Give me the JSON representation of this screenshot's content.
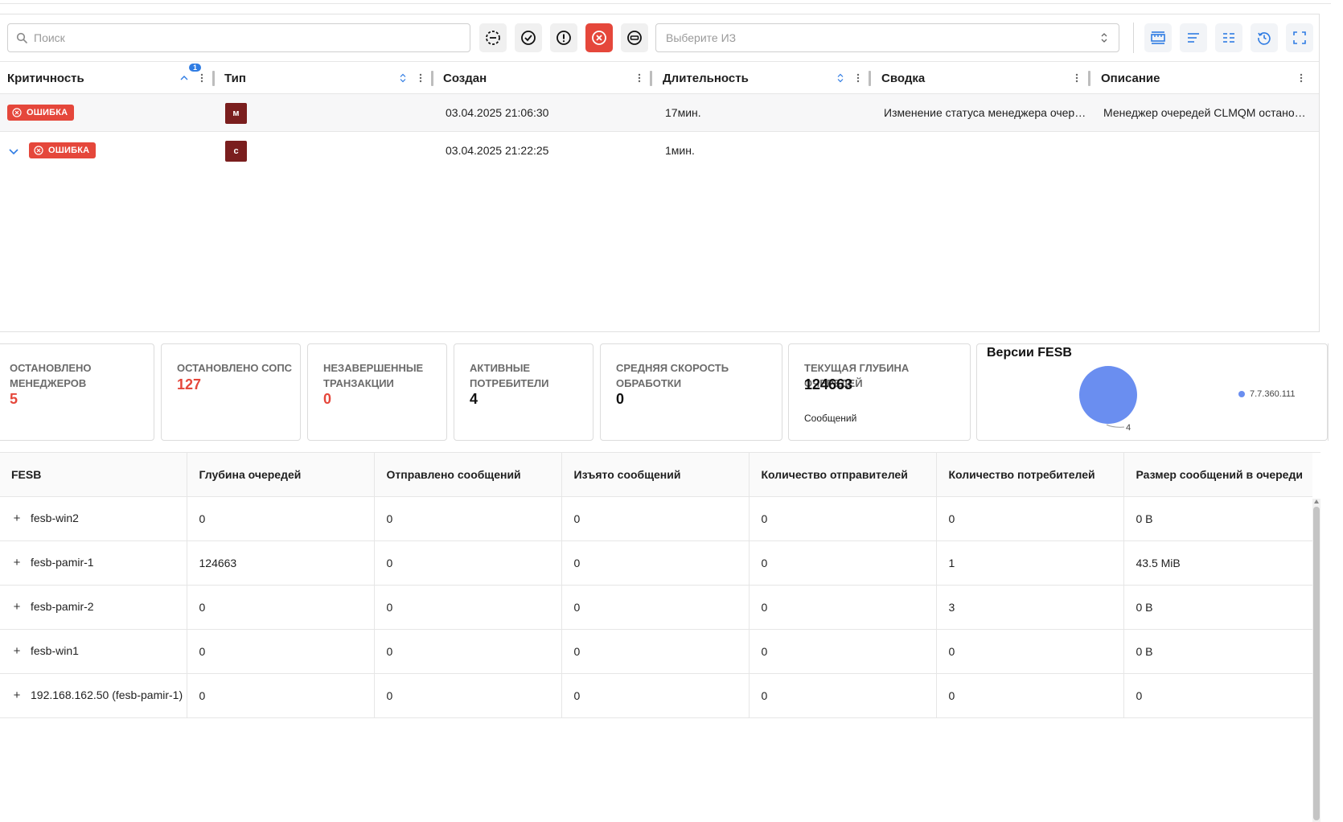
{
  "search": {
    "placeholder": "Поиск"
  },
  "select": {
    "placeholder": "Выберите ИЗ"
  },
  "alerts_table": {
    "sort_badge": "1",
    "columns": [
      "Критичность",
      "Тип",
      "Создан",
      "Длительность",
      "Сводка",
      "Описание"
    ],
    "rows": [
      {
        "severity": "ОШИБКА",
        "type": "м",
        "created": "03.04.2025 21:06:30",
        "duration": "17мин.",
        "summary": "Изменение статуса менеджера очереди",
        "description": "Менеджер очередей CLMQM остановлен"
      },
      {
        "severity": "ОШИБКА",
        "type": "с",
        "created": "03.04.2025 21:22:25",
        "duration": "1мин.",
        "summary": "",
        "description": ""
      }
    ]
  },
  "stats": {
    "stopped_managers": {
      "label": "Остановлено менеджеров",
      "value": "5"
    },
    "stopped_sops": {
      "label": "Остановлено СОПС",
      "value": "127"
    },
    "unfinished_tx": {
      "label": "Незавершенные транзакции",
      "value": "0"
    },
    "active_consumers": {
      "label": "Активные потребители",
      "value": "4"
    },
    "avg_speed": {
      "label": "Средняя скорость обработки",
      "value": "0"
    },
    "queue_depth": {
      "label": "Текущая глубина очередей",
      "value": "124663",
      "sub": "Сообщений"
    }
  },
  "versions_card": {
    "title": "Версии FESB"
  },
  "chart_data": {
    "type": "pie",
    "title": "Версии FESB",
    "series": [
      {
        "name": "7.7.360.111",
        "value": 4
      }
    ],
    "labels": [
      "4"
    ],
    "legend_position": "right",
    "colors": [
      "#6a8ef0"
    ]
  },
  "fesb_table": {
    "columns": [
      "FESB",
      "Глубина очередей",
      "Отправлено сообщений",
      "Изъято сообщений",
      "Количество отправителей",
      "Количество потребителей",
      "Размер сообщений в очереди"
    ],
    "rows": [
      [
        "fesb-win2",
        "0",
        "0",
        "0",
        "0",
        "0",
        "0 B"
      ],
      [
        "fesb-pamir-1",
        "124663",
        "0",
        "0",
        "0",
        "1",
        "43.5 MiB"
      ],
      [
        "fesb-pamir-2",
        "0",
        "0",
        "0",
        "0",
        "3",
        "0 B"
      ],
      [
        "fesb-win1",
        "0",
        "0",
        "0",
        "0",
        "0",
        "0 B"
      ],
      [
        "192.168.162.50 (fesb-pamir-1)",
        "0",
        "0",
        "0",
        "0",
        "0",
        "0"
      ]
    ]
  },
  "colors": {
    "error": "#e5473b",
    "type_box": "#7a1e1e",
    "accent": "#2f7ce3",
    "pie": "#6a8ef0"
  },
  "icons": {
    "toolbar_filters": [
      "all-filter-icon",
      "check-circle-icon",
      "warning-circle-icon",
      "error-circle-icon",
      "blocked-circle-icon"
    ],
    "toolbar_tools": [
      "row-height-icon",
      "text-align-icon",
      "columns-icon",
      "history-icon",
      "fullscreen-icon"
    ]
  }
}
